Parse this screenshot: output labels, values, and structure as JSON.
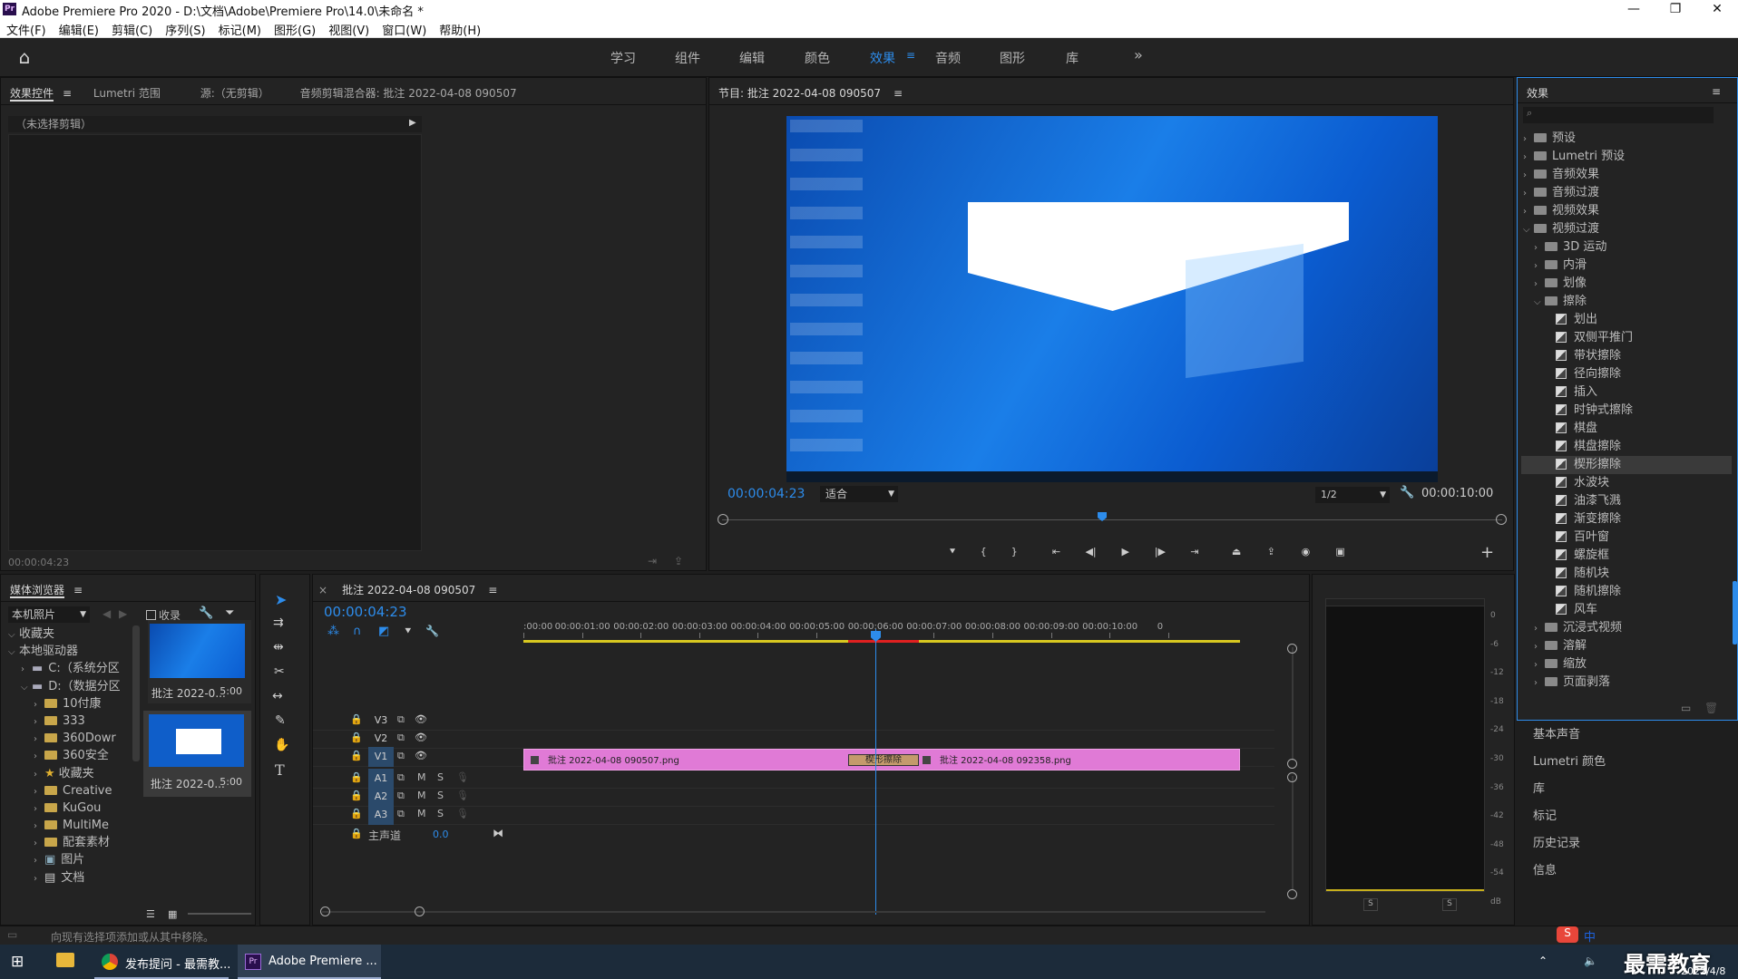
{
  "window": {
    "title": "Adobe Premiere Pro 2020 - D:\\文档\\Adobe\\Premiere Pro\\14.0\\未命名 *",
    "logo": "Pr",
    "min": "—",
    "max": "❐",
    "close": "✕"
  },
  "menu": [
    "文件(F)",
    "编辑(E)",
    "剪辑(C)",
    "序列(S)",
    "标记(M)",
    "图形(G)",
    "视图(V)",
    "窗口(W)",
    "帮助(H)"
  ],
  "workspaces": [
    {
      "label": "学习"
    },
    {
      "label": "组件"
    },
    {
      "label": "编辑"
    },
    {
      "label": "颜色"
    },
    {
      "label": "效果",
      "active": true
    },
    {
      "label": "音频"
    },
    {
      "label": "图形"
    },
    {
      "label": "库"
    }
  ],
  "workspace_more": "»",
  "source_panel": {
    "tabs": [
      "效果控件",
      "Lumetri 范围",
      "源:（无剪辑）",
      "音频剪辑混合器: 批注 2022-04-08 090507"
    ],
    "no_clip": "（未选择剪辑）",
    "timecode": "00:00:04:23"
  },
  "program": {
    "title": "节目: 批注 2022-04-08 090507",
    "timecode": "00:00:04:23",
    "fit": "适合",
    "resolution": "1/2",
    "duration": "00:00:10:00"
  },
  "media_browser": {
    "title": "媒体浏览器",
    "location": "本机照片",
    "ingest": "收录",
    "tree": [
      {
        "label": "收藏夹",
        "level": 0,
        "arrow": "v"
      },
      {
        "label": "本地驱动器",
        "level": 0,
        "arrow": "v"
      },
      {
        "label": "C:（系统分区",
        "level": 1,
        "arrow": ">",
        "icon": "drive"
      },
      {
        "label": "D:（数据分区",
        "level": 1,
        "arrow": "v",
        "icon": "drive"
      },
      {
        "label": "10付康",
        "level": 2,
        "arrow": ">",
        "icon": "folder"
      },
      {
        "label": "333",
        "level": 2,
        "arrow": ">",
        "icon": "folder"
      },
      {
        "label": "360Dowr",
        "level": 2,
        "arrow": ">",
        "icon": "folder"
      },
      {
        "label": "360安全",
        "level": 2,
        "arrow": ">",
        "icon": "folder"
      },
      {
        "label": "收藏夹",
        "level": 2,
        "arrow": ">",
        "icon": "star"
      },
      {
        "label": "Creative",
        "level": 2,
        "arrow": ">",
        "icon": "folder"
      },
      {
        "label": "KuGou",
        "level": 2,
        "arrow": ">",
        "icon": "folder"
      },
      {
        "label": "MultiMe",
        "level": 2,
        "arrow": ">",
        "icon": "folder"
      },
      {
        "label": "配套素材",
        "level": 2,
        "arrow": ">",
        "icon": "folder"
      },
      {
        "label": "图片",
        "level": 2,
        "arrow": ">",
        "icon": "image"
      },
      {
        "label": "文档",
        "level": 2,
        "arrow": ">",
        "icon": "doc"
      }
    ],
    "thumbs": [
      {
        "name": "批注 2022-0...",
        "duration": "5:00"
      },
      {
        "name": "批注 2022-0...",
        "duration": "5:00"
      }
    ]
  },
  "status": "向现有选择项添加或从其中移除。",
  "timeline": {
    "title": "批注 2022-04-08 090507",
    "timecode": "00:00:04:23",
    "ruler": [
      ":00:00",
      "00:00:01:00",
      "00:00:02:00",
      "00:00:03:00",
      "00:00:04:00",
      "00:00:05:00",
      "00:00:06:00",
      "00:00:07:00",
      "00:00:08:00",
      "00:00:09:00",
      "00:00:10:00",
      "0"
    ],
    "video_tracks": [
      "V3",
      "V2",
      "V1"
    ],
    "audio_tracks": [
      "A1",
      "A2",
      "A3"
    ],
    "mute": "M",
    "solo": "S",
    "master_label": "主声道",
    "master_value": "0.0",
    "clip1": "批注 2022-04-08 090507.png",
    "clip2": "批注 2022-04-08 092358.png",
    "transition": "楔形擦除"
  },
  "meter": {
    "scale": [
      "0",
      "-6",
      "-12",
      "-18",
      "-24",
      "-30",
      "-36",
      "-42",
      "-48",
      "-54",
      "dB"
    ],
    "solo_left": "S",
    "solo_right": "S"
  },
  "effects": {
    "title": "效果",
    "tree": [
      {
        "label": "预设",
        "level": 0,
        "arrow": ">",
        "icon": "bin"
      },
      {
        "label": "Lumetri 预设",
        "level": 0,
        "arrow": ">",
        "icon": "bin"
      },
      {
        "label": "音频效果",
        "level": 0,
        "arrow": ">",
        "icon": "folder"
      },
      {
        "label": "音频过渡",
        "level": 0,
        "arrow": ">",
        "icon": "folder"
      },
      {
        "label": "视频效果",
        "level": 0,
        "arrow": ">",
        "icon": "folder"
      },
      {
        "label": "视频过渡",
        "level": 0,
        "arrow": "v",
        "icon": "folder"
      },
      {
        "label": "3D 运动",
        "level": 1,
        "arrow": ">",
        "icon": "folder"
      },
      {
        "label": "内滑",
        "level": 1,
        "arrow": ">",
        "icon": "folder"
      },
      {
        "label": "划像",
        "level": 1,
        "arrow": ">",
        "icon": "folder"
      },
      {
        "label": "擦除",
        "level": 1,
        "arrow": "v",
        "icon": "folder"
      },
      {
        "label": "划出",
        "level": 2,
        "icon": "fx"
      },
      {
        "label": "双侧平推门",
        "level": 2,
        "icon": "fx"
      },
      {
        "label": "带状擦除",
        "level": 2,
        "icon": "fx"
      },
      {
        "label": "径向擦除",
        "level": 2,
        "icon": "fx"
      },
      {
        "label": "插入",
        "level": 2,
        "icon": "fx"
      },
      {
        "label": "时钟式擦除",
        "level": 2,
        "icon": "fx"
      },
      {
        "label": "棋盘",
        "level": 2,
        "icon": "fx"
      },
      {
        "label": "棋盘擦除",
        "level": 2,
        "icon": "fx"
      },
      {
        "label": "楔形擦除",
        "level": 2,
        "icon": "fx",
        "selected": true
      },
      {
        "label": "水波块",
        "level": 2,
        "icon": "fx"
      },
      {
        "label": "油漆飞溅",
        "level": 2,
        "icon": "fx"
      },
      {
        "label": "渐变擦除",
        "level": 2,
        "icon": "fx"
      },
      {
        "label": "百叶窗",
        "level": 2,
        "icon": "fx"
      },
      {
        "label": "螺旋框",
        "level": 2,
        "icon": "fx"
      },
      {
        "label": "随机块",
        "level": 2,
        "icon": "fx"
      },
      {
        "label": "随机擦除",
        "level": 2,
        "icon": "fx"
      },
      {
        "label": "风车",
        "level": 2,
        "icon": "fx"
      },
      {
        "label": "沉浸式视频",
        "level": 1,
        "arrow": ">",
        "icon": "folder"
      },
      {
        "label": "溶解",
        "level": 1,
        "arrow": ">",
        "icon": "folder"
      },
      {
        "label": "缩放",
        "level": 1,
        "arrow": ">",
        "icon": "folder"
      },
      {
        "label": "页面剥落",
        "level": 1,
        "arrow": ">",
        "icon": "folder"
      }
    ]
  },
  "right_panels": [
    "基本声音",
    "Lumetri 颜色",
    "库",
    "标记",
    "历史记录",
    "信息"
  ],
  "taskbar": {
    "chrome": "发布提问 - 最需教...",
    "premiere": "Adobe Premiere ...",
    "ime": "中",
    "date": "2022/4/8",
    "watermark": "最需教育"
  },
  "accent": "#2d8ceb",
  "clip_color": "#e07ad6"
}
